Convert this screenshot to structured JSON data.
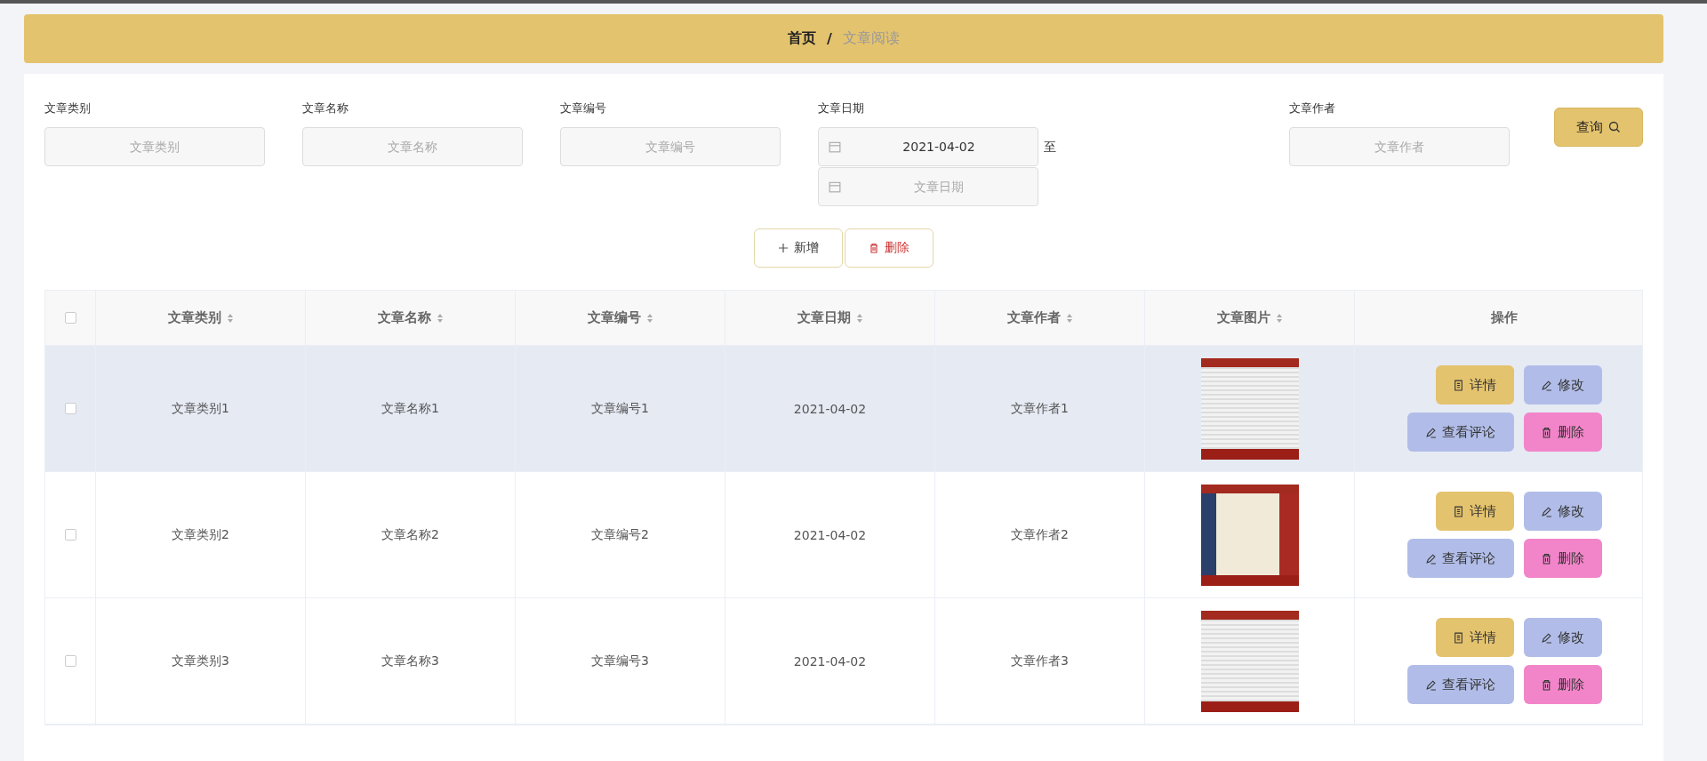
{
  "breadcrumb": {
    "home": "首页",
    "separator": "/",
    "current": "文章阅读"
  },
  "filters": [
    {
      "kind": "text",
      "label": "文章类别",
      "placeholder": "文章类别"
    },
    {
      "kind": "text",
      "label": "文章名称",
      "placeholder": "文章名称"
    },
    {
      "kind": "text",
      "label": "文章编号",
      "placeholder": "文章编号"
    },
    {
      "kind": "daterange",
      "label": "文章日期",
      "value": "2021-04-02",
      "separator": "至",
      "placeholder": "文章日期"
    },
    {
      "kind": "text",
      "label": "文章作者",
      "placeholder": "文章作者"
    }
  ],
  "search_button": "查询",
  "actions": [
    {
      "kind": "add",
      "label": "新增"
    },
    {
      "kind": "delete",
      "label": "删除"
    }
  ],
  "table": {
    "select_all_checked": false,
    "columns": [
      {
        "label": "文章类别",
        "sortable": true
      },
      {
        "label": "文章名称",
        "sortable": true
      },
      {
        "label": "文章编号",
        "sortable": true
      },
      {
        "label": "文章日期",
        "sortable": true
      },
      {
        "label": "文章作者",
        "sortable": true
      },
      {
        "label": "文章图片",
        "sortable": true
      },
      {
        "label": "操作",
        "sortable": false
      }
    ],
    "rows": [
      {
        "checked": false,
        "highlighted": true,
        "cells": [
          "文章类别1",
          "文章名称1",
          "文章编号1",
          "2021-04-02",
          "文章作者1"
        ],
        "buttons": [
          {
            "kind": "detail",
            "label": "详情"
          },
          {
            "kind": "edit",
            "label": "修改"
          },
          {
            "kind": "comments",
            "label": "查看评论"
          },
          {
            "kind": "delete",
            "label": "删除"
          }
        ]
      },
      {
        "checked": false,
        "highlighted": false,
        "cells": [
          "文章类别2",
          "文章名称2",
          "文章编号2",
          "2021-04-02",
          "文章作者2"
        ],
        "buttons": [
          {
            "kind": "detail",
            "label": "详情"
          },
          {
            "kind": "edit",
            "label": "修改"
          },
          {
            "kind": "comments",
            "label": "查看评论"
          },
          {
            "kind": "delete",
            "label": "删除"
          }
        ]
      },
      {
        "checked": false,
        "highlighted": false,
        "cells": [
          "文章类别3",
          "文章名称3",
          "文章编号3",
          "2021-04-02",
          "文章作者3"
        ],
        "buttons": [
          {
            "kind": "detail",
            "label": "详情"
          },
          {
            "kind": "edit",
            "label": "修改"
          },
          {
            "kind": "comments",
            "label": "查看评论"
          },
          {
            "kind": "delete",
            "label": "删除"
          }
        ]
      }
    ]
  }
}
